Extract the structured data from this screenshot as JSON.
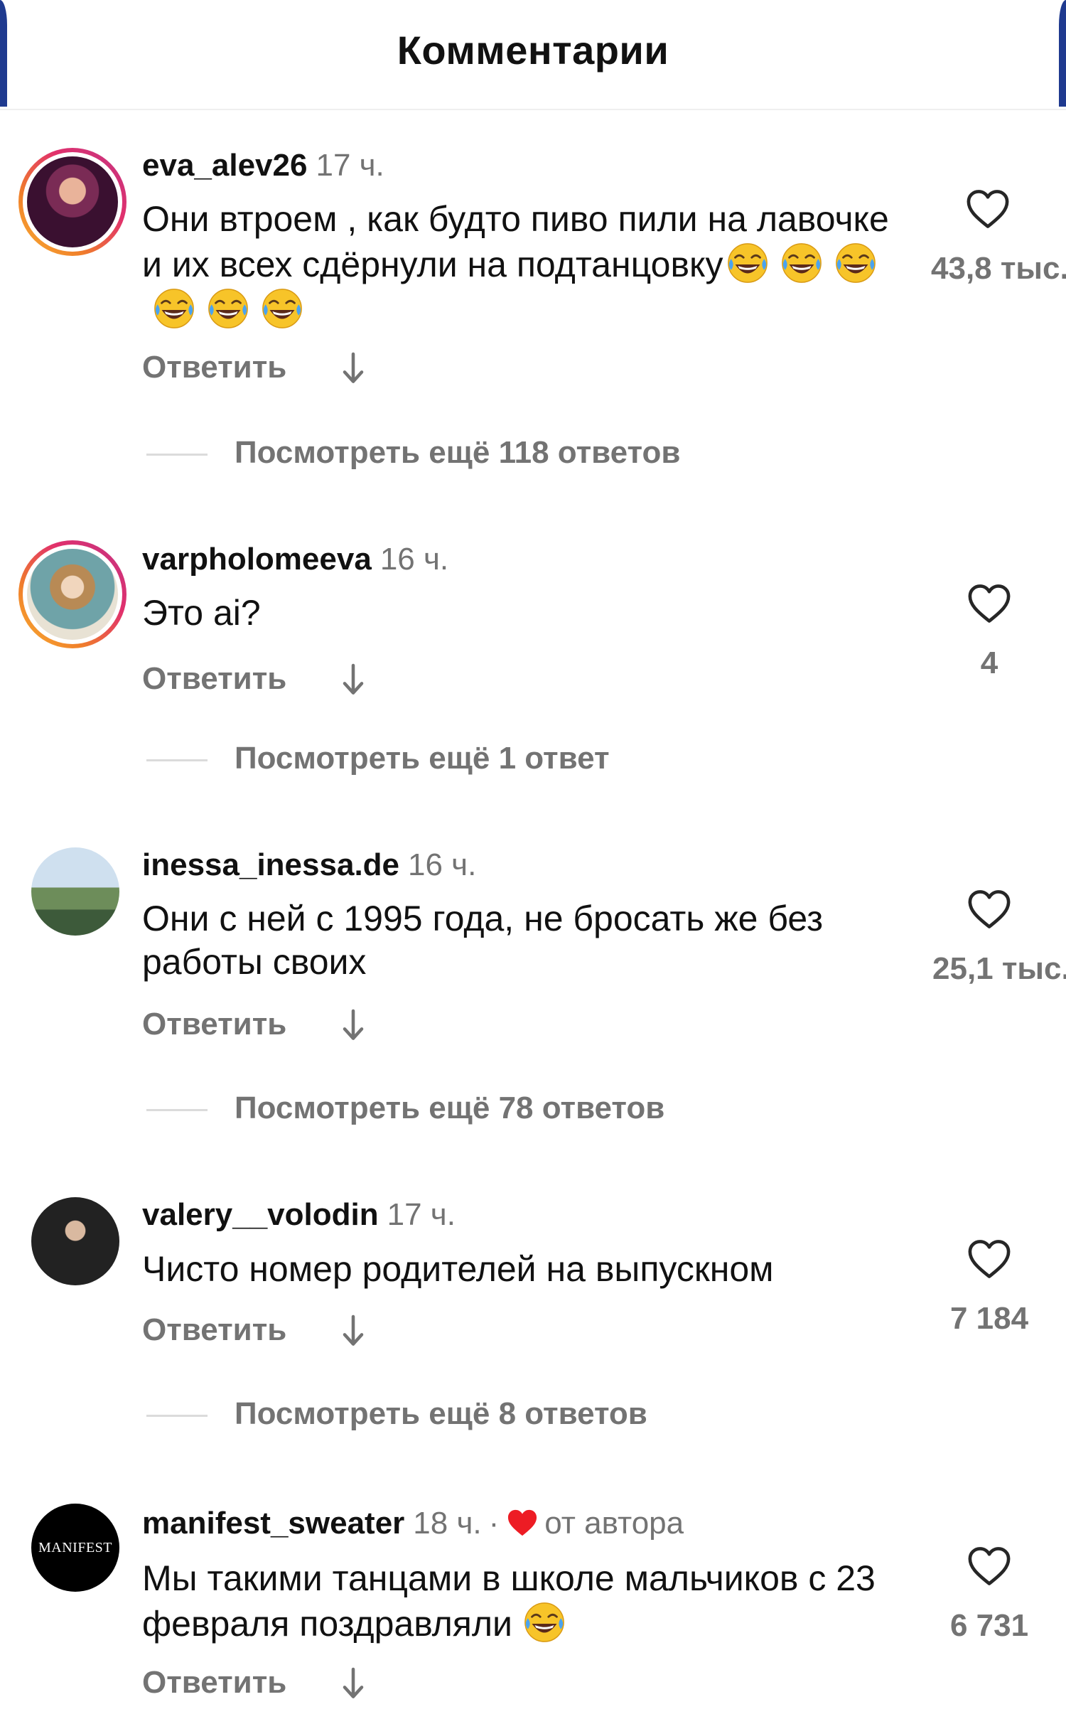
{
  "header": {
    "title": "Комментарии"
  },
  "comments": [
    {
      "username": "eva_alev26",
      "time": "17 ч.",
      "text": "Они втроем , как будто пиво пили на лавочке и их всех сдёрнули на подтанцовку",
      "emoji_count": 6,
      "reply_label": "Ответить",
      "likes": "43,8 тыс.",
      "view_more": "Посмотреть ещё 118 ответов",
      "has_story_ring": true
    },
    {
      "username": "varpholomeeva",
      "time": "16 ч.",
      "text": "Это ai?",
      "reply_label": "Ответить",
      "likes": "4",
      "view_more": "Посмотреть ещё 1 ответ",
      "has_story_ring": true
    },
    {
      "username": "inessa_inessa.de",
      "time": "16 ч.",
      "text": "Они с ней с 1995 года, не бросать же без работы своих",
      "reply_label": "Ответить",
      "likes": "25,1 тыс.",
      "view_more": "Посмотреть ещё 78 ответов",
      "has_story_ring": false
    },
    {
      "username": "valery__volodin",
      "time": "17 ч.",
      "text": "Чисто номер родителей на выпускном",
      "reply_label": "Ответить",
      "likes": "7 184",
      "view_more": "Посмотреть ещё 8 ответов",
      "has_story_ring": false
    },
    {
      "username": "manifest_sweater",
      "time": "18 ч.",
      "separator": "·",
      "author_badge": "от автора",
      "avatar_logo_text": "MANIFEST",
      "text": "Мы такими танцами в школе мальчиков с 23 февраля поздравляли",
      "emoji_count": 1,
      "reply_label": "Ответить",
      "likes": "6 731",
      "has_story_ring": false
    }
  ],
  "icons": {
    "like": "heart-outline-icon",
    "translate": "arrow-down-icon",
    "author_like": "heart-filled-icon",
    "emoji": "face-with-tears-of-joy-emoji"
  },
  "colors": {
    "text_primary": "#111111",
    "text_secondary": "#737373",
    "author_heart": "#ed1c24",
    "divider": "#dbdbdb",
    "edge": "#1f3a8f"
  }
}
